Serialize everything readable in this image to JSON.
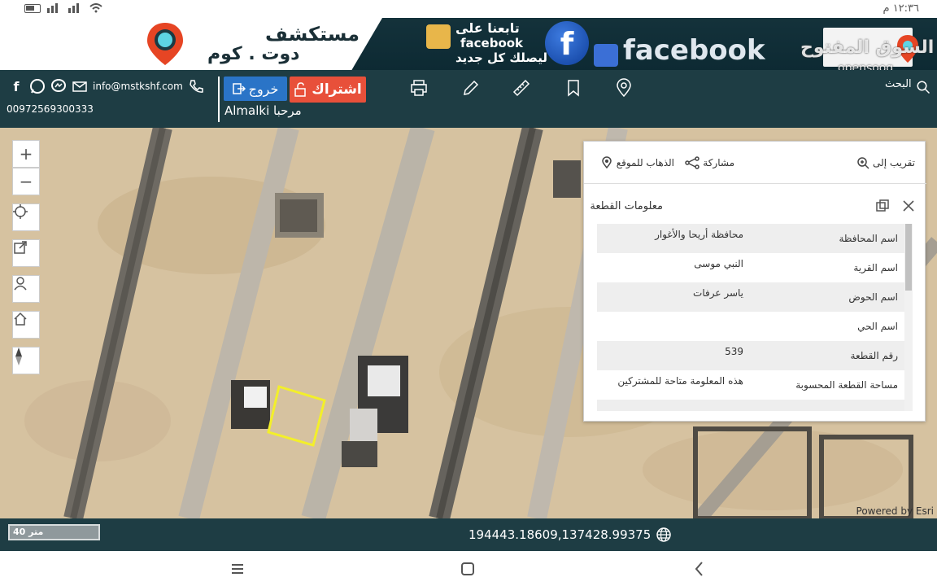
{
  "status_bar": {
    "time": "١٢:٣٦ م"
  },
  "banner": {
    "ad_title": "مستكشف",
    "ad_sub": "دوت . كوم",
    "fb_follow": "تابعنا على",
    "fb_name": "facebook",
    "fb_sub": "ليصلك كل جديد",
    "fb_word": "facebook",
    "watermark": "السوق المفتوح",
    "watermark_sub": "opensooq"
  },
  "toolbar": {
    "email": "info@mstkshf.com",
    "phone": "00972569300333",
    "logout_label": "خروج",
    "subscribe_label": "اشتراك",
    "greeting": "Almalki مرحبا",
    "search_label": "البحث"
  },
  "panel": {
    "actions": {
      "goto_label": "الذهاب للموقع",
      "share_label": "مشاركة",
      "zoom_label": "تقريب إلى"
    },
    "title": "معلومات القطعة",
    "rows": [
      {
        "key": "اسم المحافظة",
        "value": "محافظة أريحا والأغوار"
      },
      {
        "key": "اسم القرية",
        "value": "النبي موسى"
      },
      {
        "key": "اسم الحوض",
        "value": "ياسر عرفات"
      },
      {
        "key": "اسم الحي",
        "value": ""
      },
      {
        "key": "رقم القطعة",
        "value": "539"
      },
      {
        "key": "مساحة القطعة المحسوبة",
        "value": "هذه المعلومة متاحة للمشتركين"
      }
    ]
  },
  "map": {
    "attribution": "Powered by Esri"
  },
  "bottom_bar": {
    "scale_label": "40 متر",
    "coordinates": "194443.18609,137428.99375"
  }
}
